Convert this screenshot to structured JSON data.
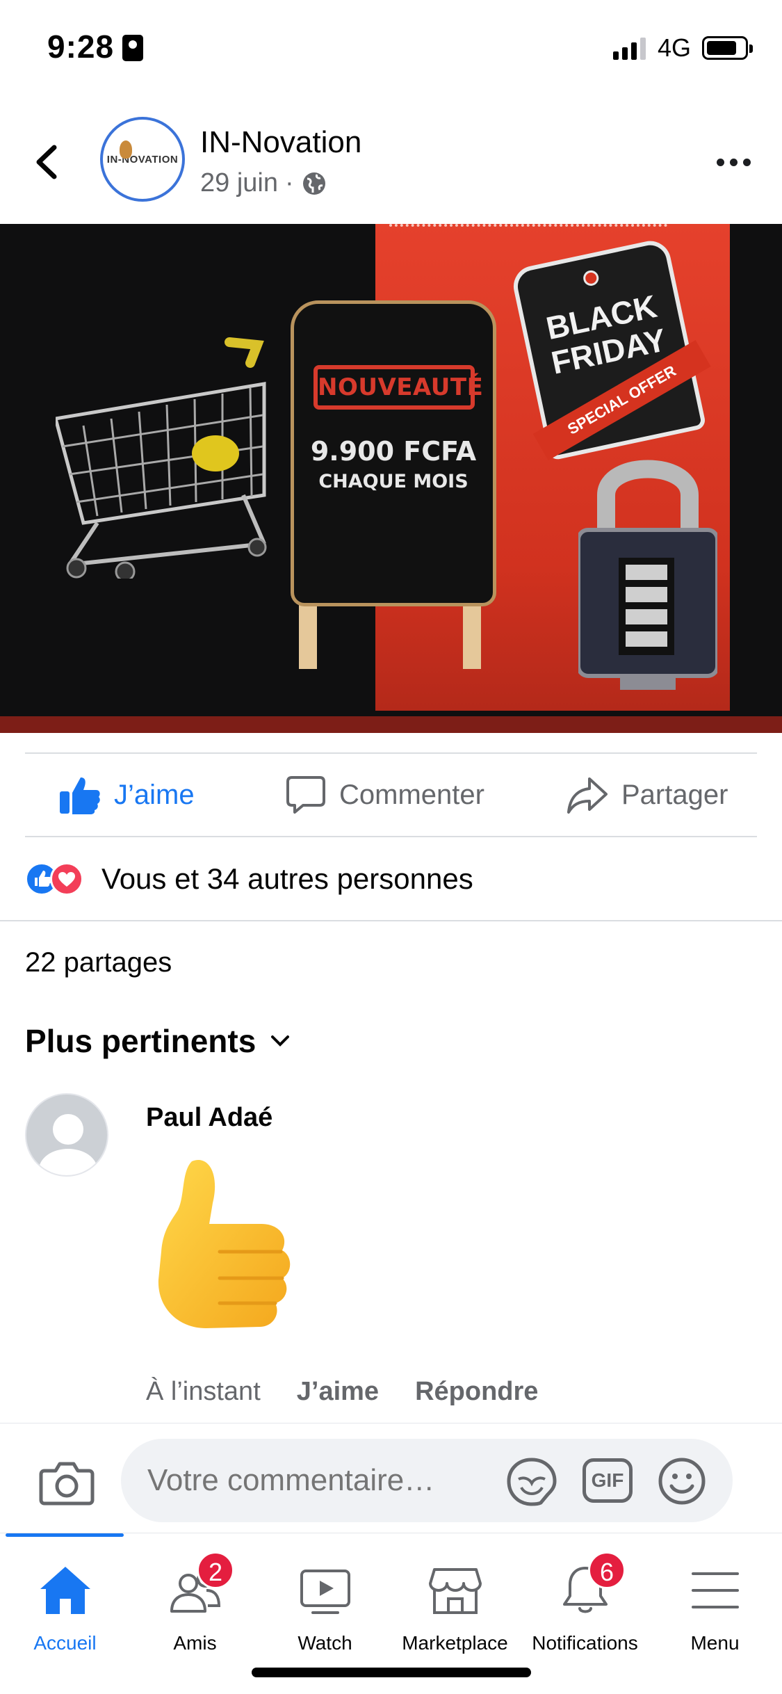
{
  "status_bar": {
    "time": "9:28",
    "network": "4G"
  },
  "post": {
    "page_name": "IN-Novation",
    "date": "29 juin",
    "separator": "·",
    "logo_text": "IN-NOVATION",
    "image": {
      "badge": "NOUVEAUTÉ",
      "price": "9.900 FCFA",
      "period": "CHAQUE MOIS",
      "tag_title_1": "BLACK",
      "tag_title_2": "FRIDAY",
      "tag_ribbon": "SPECIAL OFFER"
    },
    "actions": {
      "like": "J’aime",
      "comment": "Commenter",
      "share": "Partager"
    },
    "reactions_text": "Vous et 34 autres personnes",
    "shares": "22 partages",
    "sort_label": "Plus pertinents"
  },
  "comment": {
    "author": "Paul Adaé",
    "time": "À l’instant",
    "like": "J’aime",
    "reply": "Répondre"
  },
  "composer": {
    "placeholder": "Votre commentaire…",
    "gif_label": "GIF"
  },
  "nav": {
    "items": [
      {
        "label": "Accueil",
        "icon": "home-icon"
      },
      {
        "label": "Amis",
        "icon": "friends-icon",
        "badge": "2"
      },
      {
        "label": "Watch",
        "icon": "watch-icon"
      },
      {
        "label": "Marketplace",
        "icon": "marketplace-icon"
      },
      {
        "label": "Notifications",
        "icon": "bell-icon",
        "badge": "6"
      },
      {
        "label": "Menu",
        "icon": "menu-icon"
      }
    ]
  },
  "colors": {
    "accent": "#1877f2",
    "badge": "#e41e3f",
    "secondary_text": "#65676b"
  }
}
